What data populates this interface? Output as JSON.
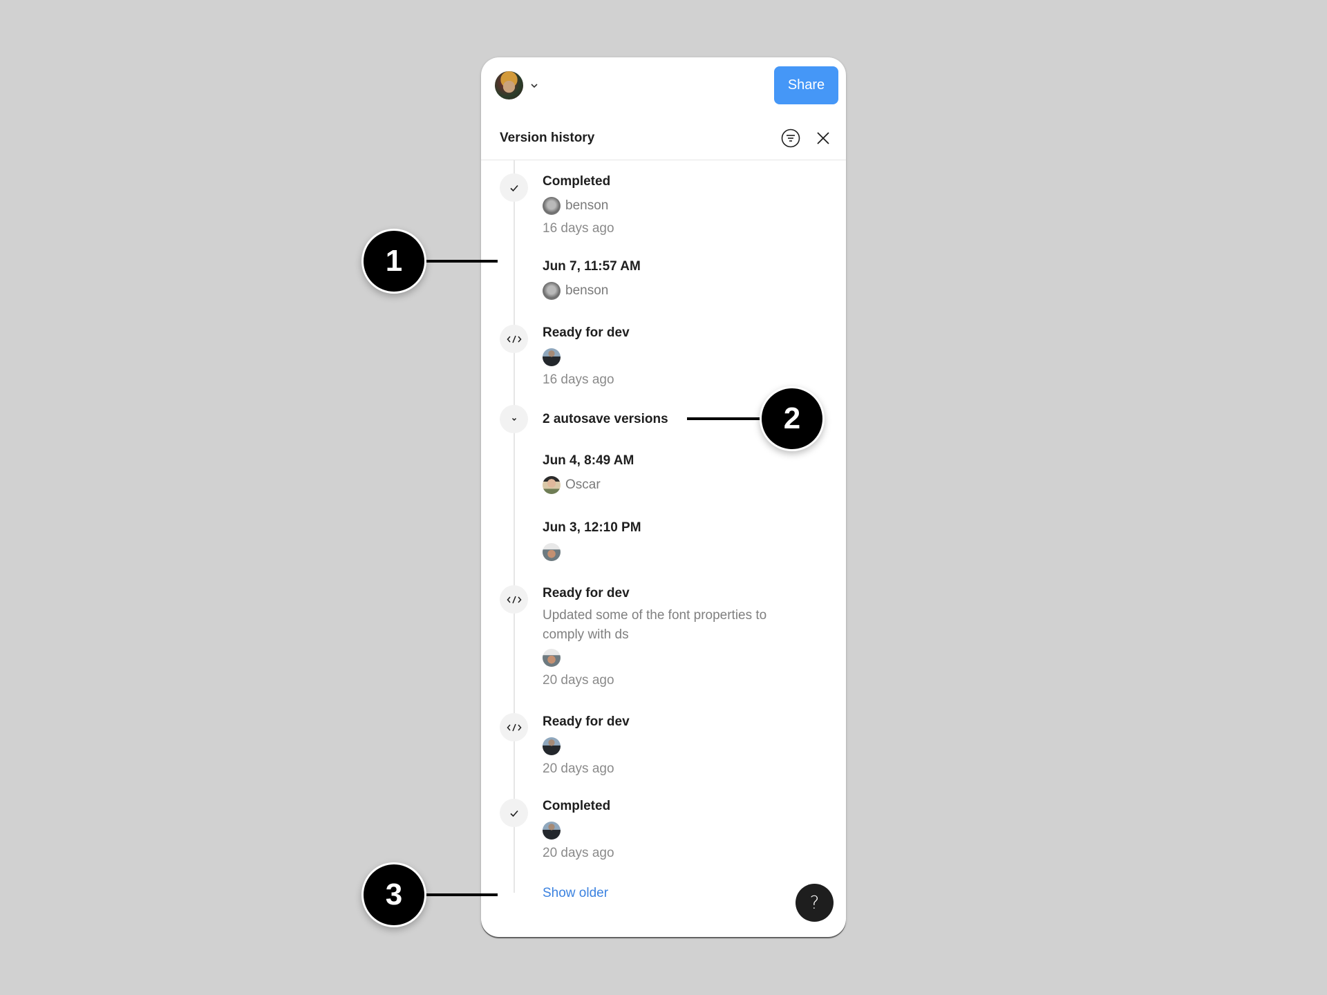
{
  "topbar": {
    "avatar_icon": "user-avatar",
    "chevron_icon": "chevron-down-icon",
    "share_label": "Share",
    "share_color": "#4597f7"
  },
  "header": {
    "title": "Version history",
    "filter_icon": "filter-icon",
    "close_icon": "close-icon"
  },
  "versions": [
    {
      "type": "status",
      "icon": "check-icon",
      "title": "Completed",
      "author": "benson",
      "time": "16 days ago"
    },
    {
      "type": "version",
      "title": "Jun 7, 11:57 AM",
      "author": "benson"
    },
    {
      "type": "status",
      "icon": "code-icon",
      "title": "Ready for dev",
      "author": "",
      "time": "16 days ago"
    },
    {
      "type": "autosave-group",
      "icon": "chevron-down-icon",
      "title": "2 autosave versions",
      "items": [
        {
          "title": "Jun 4, 8:49 AM",
          "author": "Oscar"
        },
        {
          "title": "Jun 3, 12:10 PM",
          "author": ""
        }
      ]
    },
    {
      "type": "status",
      "icon": "code-icon",
      "title": "Ready for dev",
      "description": "Updated some of the font properties to comply with ds",
      "author": "",
      "time": "20 days ago"
    },
    {
      "type": "status",
      "icon": "code-icon",
      "title": "Ready for dev",
      "author": "",
      "time": "20 days ago"
    },
    {
      "type": "status",
      "icon": "check-icon",
      "title": "Completed",
      "author": "",
      "time": "20 days ago"
    }
  ],
  "footer": {
    "show_older_label": "Show older",
    "show_older_color": "#3b82e0",
    "help_label": "?"
  },
  "callouts": [
    "1",
    "2",
    "3"
  ]
}
